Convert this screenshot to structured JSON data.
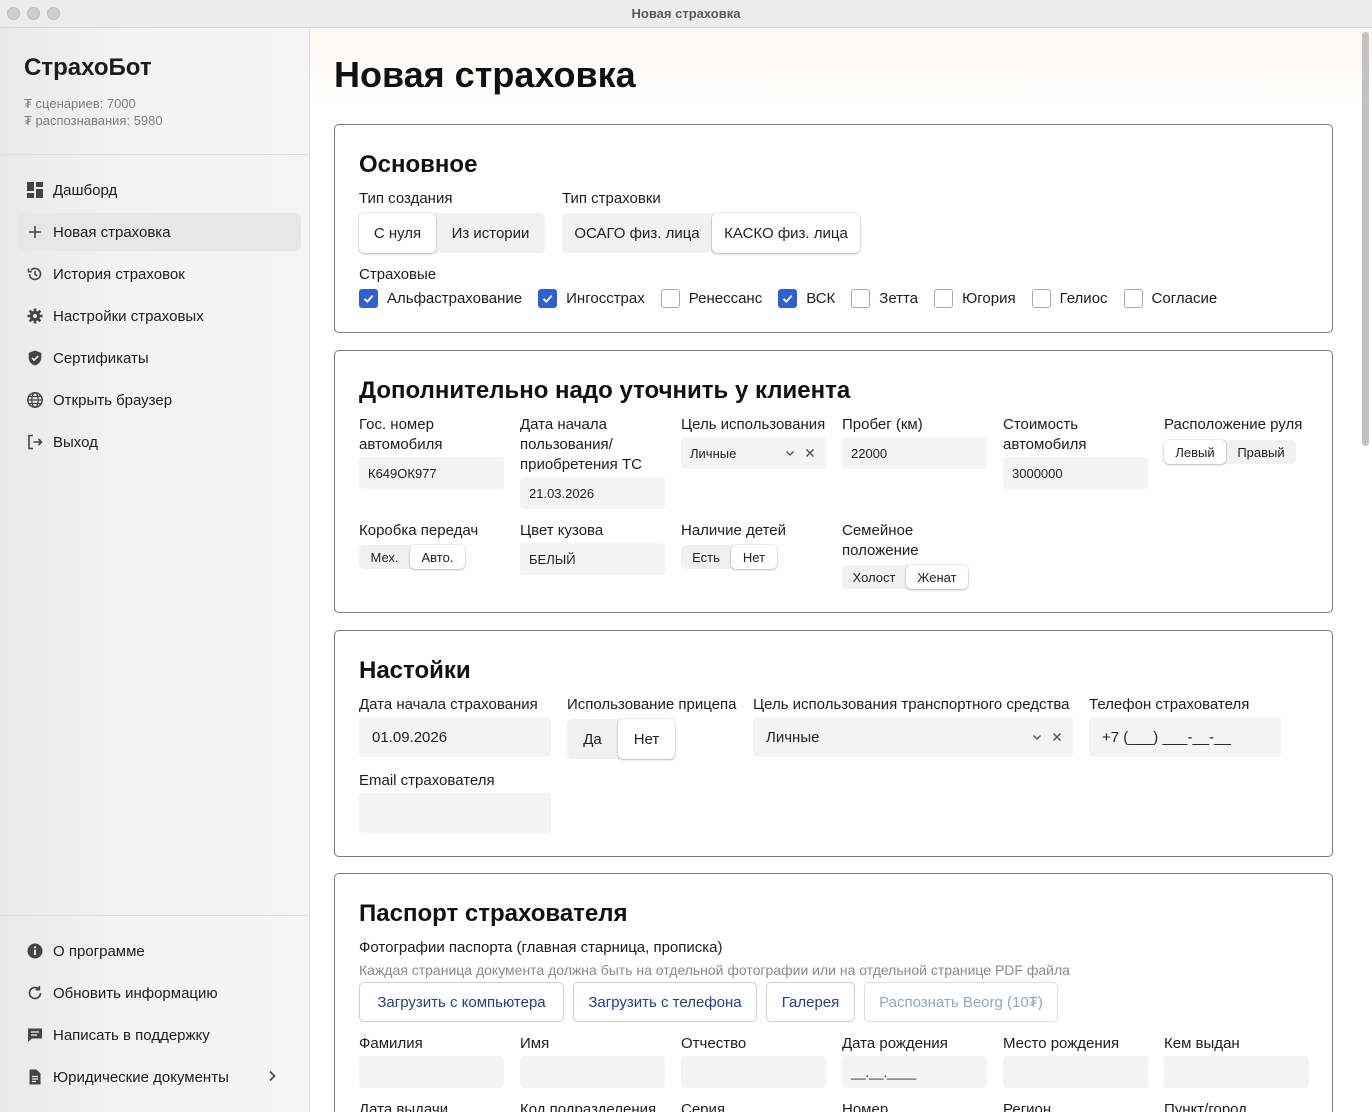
{
  "window": {
    "title": "Новая страховка"
  },
  "sidebar": {
    "brand": "СтрахоБот",
    "stats": [
      "₮ сценариев: 7000",
      "₮ распознавания: 5980"
    ],
    "items": [
      {
        "label": "Дашборд",
        "icon": "dashboard-icon"
      },
      {
        "label": "Новая страховка",
        "icon": "plus-icon",
        "active": true
      },
      {
        "label": "История страховок",
        "icon": "history-icon"
      },
      {
        "label": "Настройки страховых",
        "icon": "gear-icon"
      },
      {
        "label": "Сертификаты",
        "icon": "shield-icon"
      },
      {
        "label": "Открыть браузер",
        "icon": "globe-icon"
      },
      {
        "label": "Выход",
        "icon": "logout-icon"
      }
    ],
    "bottom_items": [
      {
        "label": "О программе",
        "icon": "info-icon"
      },
      {
        "label": "Обновить информацию",
        "icon": "refresh-icon"
      },
      {
        "label": "Написать в поддержку",
        "icon": "chat-icon"
      },
      {
        "label": "Юридические документы",
        "icon": "document-icon"
      }
    ]
  },
  "main": {
    "title": "Новая страховка",
    "basic": {
      "title": "Основное",
      "creation_type_label": "Тип создания",
      "creation_type_options": [
        "С нуля",
        "Из истории"
      ],
      "creation_type_selected": "С нуля",
      "insurance_type_label": "Тип страховки",
      "insurance_type_options": [
        "ОСАГО физ. лица",
        "КАСКО физ. лица"
      ],
      "insurance_type_selected": "КАСКО физ. лица",
      "insurers_label": "Страховые",
      "insurers": [
        {
          "name": "Альфастрахование",
          "checked": true
        },
        {
          "name": "Ингосстрах",
          "checked": true
        },
        {
          "name": "Ренессанс",
          "checked": false
        },
        {
          "name": "ВСК",
          "checked": true
        },
        {
          "name": "Зетта",
          "checked": false
        },
        {
          "name": "Югория",
          "checked": false
        },
        {
          "name": "Гелиос",
          "checked": false
        },
        {
          "name": "Согласие",
          "checked": false
        }
      ]
    },
    "client": {
      "title": "Дополнительно надо уточнить у клиента",
      "plate_label": "Гос. номер автомобиля",
      "plate_value": "К649ОК977",
      "start_date_label": "Дата начала пользования/ приобретения ТС",
      "start_date_value": "21.03.2026",
      "purpose_label": "Цель использования",
      "purpose_value": "Личные",
      "mileage_label": "Пробег (км)",
      "mileage_value": "22000",
      "cost_label": "Стоимость автомобиля",
      "cost_value": "3000000",
      "wheel_label": "Расположение руля",
      "wheel_options": [
        "Левый",
        "Правый"
      ],
      "wheel_selected": "Левый",
      "gearbox_label": "Коробка передач",
      "gearbox_options": [
        "Мех.",
        "Авто."
      ],
      "gearbox_selected": "Авто.",
      "color_label": "Цвет кузова",
      "color_value": "БЕЛЫЙ",
      "children_label": "Наличие детей",
      "children_options": [
        "Есть",
        "Нет"
      ],
      "children_selected": "Нет",
      "family_label": "Семейное положение",
      "family_options": [
        "Холост",
        "Женат"
      ],
      "family_selected": "Женат"
    },
    "settings": {
      "title": "Настойки",
      "ins_start_label": "Дата начала страхования",
      "ins_start_value": "01.09.2026",
      "trailer_label": "Использование прицепа",
      "trailer_options": [
        "Да",
        "Нет"
      ],
      "trailer_selected": "Нет",
      "vehicle_purpose_label": "Цель использования транспортного средства",
      "vehicle_purpose_value": "Личные",
      "phone_label": "Телефон страхователя",
      "phone_value": "+7 (___) ___-__-__",
      "email_label": "Email страхователя",
      "email_value": ""
    },
    "passport": {
      "title": "Паспорт страхователя",
      "photos_label": "Фотографии паспорта (главная старница, прописка)",
      "photos_hint": "Каждая страница документа должна быть на отдельной фотографии или на отдельной странице PDF файла",
      "buttons": [
        "Загрузить с компьютера",
        "Загрузить с телефона",
        "Галерея",
        "Распознать Beorg (10₮)"
      ],
      "fields": [
        "Фамилия",
        "Имя",
        "Отчество",
        "Дата рождения",
        "Место рождения",
        "Кем выдан"
      ],
      "birth_placeholder": "__.__.____",
      "fields_row2": [
        "Дата выдачи",
        "Код подразделения",
        "Серия",
        "Номер",
        "Регион",
        "Пункт/город"
      ]
    }
  }
}
